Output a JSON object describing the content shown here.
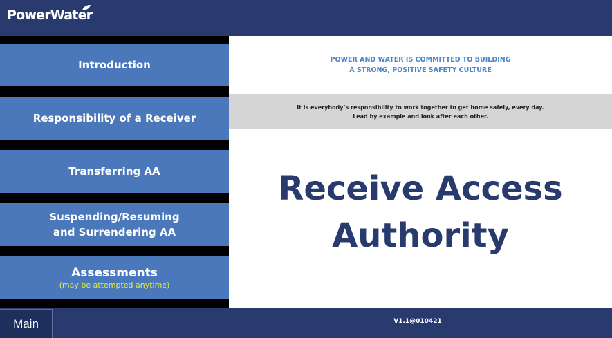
{
  "header": {
    "logo_text": "PowerWater",
    "logo_icon": "leaf-icon"
  },
  "sidebar": {
    "items": [
      {
        "label": "Introduction"
      },
      {
        "label": "Responsibility of a Receiver"
      },
      {
        "label": "Transferring AA"
      },
      {
        "label": "Suspending/Resuming",
        "label2": "and Surrendering AA"
      },
      {
        "label": "Assessments",
        "sub": "(may be attempted anytime)"
      }
    ]
  },
  "main": {
    "commitment_line1": "POWER AND WATER IS COMMITTED TO BUILDING",
    "commitment_line2": "A STRONG, POSITIVE SAFETY CULTURE",
    "safety_line1": "It is everybody’s responsibility to work together to get home safely, every day.",
    "safety_line2": "Lead by example and look after each other.",
    "title_line1": "Receive Access",
    "title_line2": "Authority"
  },
  "footer": {
    "main_tab": "Main",
    "version": "V1.1@010421"
  },
  "colors": {
    "navy": "#283a6e",
    "nav_button": "#4a78bb",
    "accent_yellow": "#e5ee3c",
    "commit_blue": "#4a86c8",
    "gray_band": "#d5d5d5"
  }
}
